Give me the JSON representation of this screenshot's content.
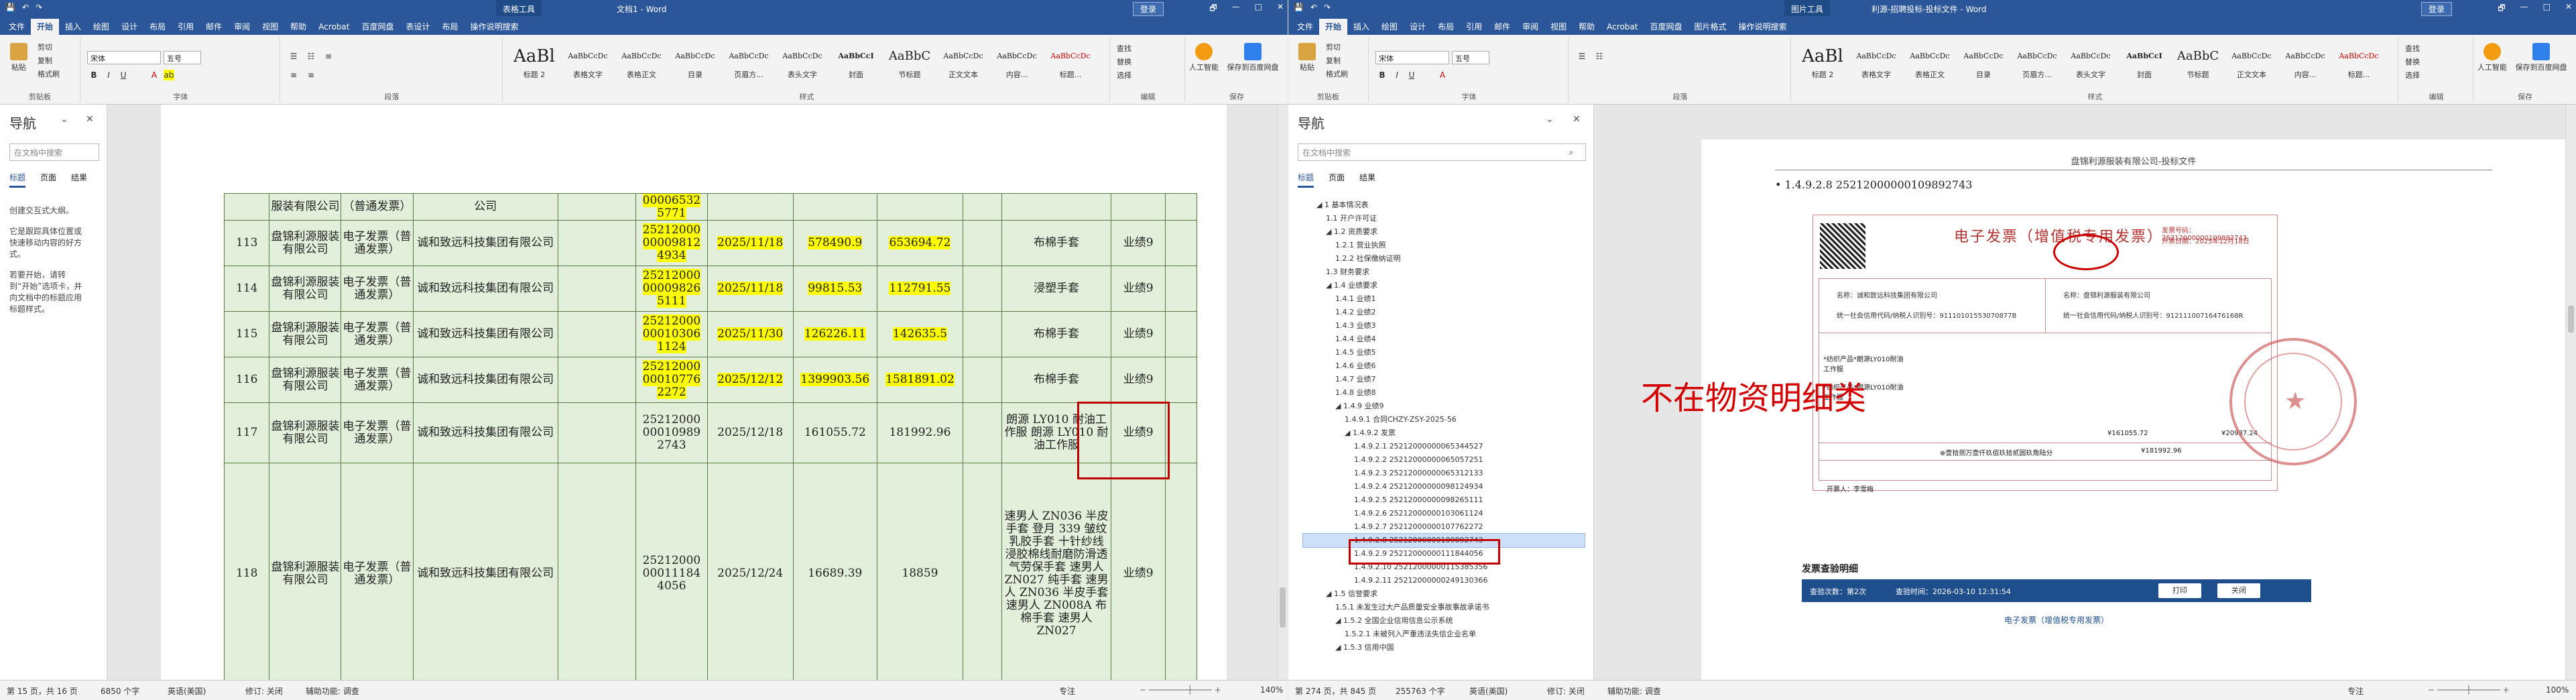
{
  "left": {
    "titlebar": {
      "context_tool": "表格工具",
      "doc_title": "文档1 - Word",
      "login": "登录",
      "controls": [
        "🗗",
        "—",
        "□",
        "✕"
      ]
    },
    "tabs": [
      "文件",
      "开始",
      "插入",
      "绘图",
      "设计",
      "布局",
      "引用",
      "邮件",
      "审阅",
      "视图",
      "帮助",
      "Acrobat",
      "百度网盘",
      "表设计",
      "布局",
      "操作说明搜索"
    ],
    "ribbon": {
      "paste": "粘贴",
      "cut": "剪切",
      "copy": "复制",
      "format_painter": "格式刷",
      "clipboard_label": "剪贴板",
      "font_name": "宋体",
      "font_size": "五号",
      "font_label": "字体",
      "paragraph_label": "段落",
      "styles_label": "样式",
      "styles": [
        {
          "preview": "AaBl",
          "name": "标题 2"
        },
        {
          "preview": "AaBbCcDc",
          "name": "表格文字"
        },
        {
          "preview": "AaBbCcDc",
          "name": "表格正文"
        },
        {
          "preview": "AaBbCcDc",
          "name": "目录"
        },
        {
          "preview": "AaBbCcDc",
          "name": "页眉方..."
        },
        {
          "preview": "AaBbCcDc",
          "name": "表头文字"
        },
        {
          "preview": "AaBbCcI",
          "name": "封面"
        },
        {
          "preview": "AaBbC",
          "name": "节标题"
        },
        {
          "preview": "AaBbCcDc",
          "name": "正文文本"
        },
        {
          "preview": "AaBbCcDc",
          "name": "内容..."
        },
        {
          "preview": "AaBbCcDc",
          "name": "标题..."
        }
      ],
      "find": "查找",
      "replace": "替换",
      "select": "选择",
      "edit_label": "编辑",
      "ai": "人工智能",
      "save_baidu": "保存到百度网盘",
      "save_label": "保存"
    },
    "nav": {
      "title": "导航",
      "search_placeholder": "在文档中搜索",
      "tabs": [
        "标题",
        "页面",
        "结果"
      ],
      "info": [
        "创建交互式大纲。",
        "它是跟踪具体位置或快速移动内容的好方式。",
        "若要开始，请转到“开始”选项卡，并向文档中的标题应用标题样式。"
      ]
    },
    "table_rows": [
      {
        "no": "",
        "company": "服装有限公司",
        "type": "（普通发票）",
        "seller": "公司",
        "inv_no": "00006532 5771",
        "date": "",
        "amount": "",
        "total": "",
        "item": "",
        "remark": "",
        "highlight": true
      },
      {
        "no": "113",
        "company": "盘锦利源服装有限公司",
        "type": "电子发票（普通发票）",
        "seller": "诚和致远科技集团有限公司",
        "inv_no": "25212000 00009812 4934",
        "date": "2025/11/18",
        "amount": "578490.9",
        "total": "653694.72",
        "item": "布棉手套",
        "remark": "业绩9",
        "highlight": true
      },
      {
        "no": "114",
        "company": "盘锦利源服装有限公司",
        "type": "电子发票（普通发票）",
        "seller": "诚和致远科技集团有限公司",
        "inv_no": "25212000 00009826 5111",
        "date": "2025/11/18",
        "amount": "99815.53",
        "total": "112791.55",
        "item": "浸塑手套",
        "remark": "业绩9",
        "highlight": true
      },
      {
        "no": "115",
        "company": "盘锦利源服装有限公司",
        "type": "电子发票（普通发票）",
        "seller": "诚和致远科技集团有限公司",
        "inv_no": "25212000 00010306 1124",
        "date": "2025/11/30",
        "amount": "126226.11",
        "total": "142635.5",
        "item": "布棉手套",
        "remark": "业绩9",
        "highlight": true
      },
      {
        "no": "116",
        "company": "盘锦利源服装有限公司",
        "type": "电子发票（普通发票）",
        "seller": "诚和致远科技集团有限公司",
        "inv_no": "25212000 00010776 2272",
        "date": "2025/12/12",
        "amount": "1399903.56",
        "total": "1581891.02",
        "item": "布棉手套",
        "remark": "业绩9",
        "highlight": true
      },
      {
        "no": "117",
        "company": "盘锦利源服装有限公司",
        "type": "电子发票（普通发票）",
        "seller": "诚和致远科技集团有限公司",
        "inv_no": "25212000 00010989 2743",
        "date": "2025/12/18",
        "amount": "161055.72",
        "total": "181992.96",
        "item": "朗源 LY010 耐油工作服 朗源 LY010 耐油工作服",
        "remark": "业绩9",
        "highlight": false
      },
      {
        "no": "118",
        "company": "盘锦利源服装有限公司",
        "type": "电子发票（普通发票）",
        "seller": "诚和致远科技集团有限公司",
        "inv_no": "25212000 00011184 4056",
        "date": "2025/12/24",
        "amount": "16689.39",
        "total": "18859",
        "item": "速男人 ZN036 半皮手套 登月 339 皱纹乳胶手套 十针纱线浸胶棉线耐磨防滑透气劳保手套 速男人 ZN027 纯手套 速男人 ZN036 半皮手套 速男人 ZN008A 布棉手套 速男人 ZN027",
        "remark": "业绩9",
        "highlight": false
      }
    ],
    "status": {
      "page": "第 15 页，共 16 页",
      "words": "6850 个字",
      "lang": "英语(美国)",
      "track": "修订: 关闭",
      "assist": "辅助功能: 调查",
      "focus": "专注",
      "zoom": "140%"
    }
  },
  "right": {
    "titlebar": {
      "context_tool": "图片工具",
      "doc_title": "利源-招聘投标-投标文件 - Word",
      "login": "登录",
      "controls": [
        "🗗",
        "—",
        "□",
        "✕"
      ]
    },
    "tabs": [
      "文件",
      "开始",
      "插入",
      "绘图",
      "设计",
      "布局",
      "引用",
      "邮件",
      "审阅",
      "视图",
      "帮助",
      "Acrobat",
      "百度网盘",
      "图片格式",
      "操作说明搜索"
    ],
    "nav": {
      "title": "导航",
      "search_placeholder": "在文档中搜索",
      "tabs": [
        "标题",
        "页面",
        "结果"
      ],
      "tree": [
        "◢ 1 基本情况表",
        "1.1 开户许可证",
        "◢ 1.2 资质要求",
        "1.2.1 营业执照",
        "1.2.2 社保缴纳证明",
        "1.3 财务要求",
        "◢ 1.4 业绩要求",
        "1.4.1 业绩1",
        "1.4.2 业绩2",
        "1.4.3 业绩3",
        "1.4.4 业绩4",
        "1.4.5 业绩5",
        "1.4.6 业绩6",
        "1.4.7 业绩7",
        "1.4.8 业绩8",
        "◢ 1.4.9 业绩9",
        "1.4.9.1 合同CHZY-ZSY-2025-56",
        "◢ 1.4.9.2 发票",
        "1.4.9.2.1 25212000000065344527",
        "1.4.9.2.2 25212000000065057251",
        "1.4.9.2.3 25212000000065312133",
        "1.4.9.2.4 25212000000098124934",
        "1.4.9.2.5 25212000000098265111",
        "1.4.9.2.6 25212000000103061124",
        "1.4.9.2.7 25212000000107762272",
        "1.4.9.2.8 25212000000109892743",
        "1.4.9.2.9 25212000000111844056",
        "1.4.9.2.10 25212000000115385356",
        "1.4.9.2.11 25212000000249130366",
        "◢ 1.5 信誉要求",
        "1.5.1 未发生过大产品质量安全事故事故承诺书",
        "◢ 1.5.2 全国企业信用信息公示系统",
        "1.5.2.1 未被列入严重违法失信企业名单",
        "◢ 1.5.3 信用中国"
      ],
      "highlight_index": 25
    },
    "page_header": "盘锦利源服装有限公司-投标文件",
    "heading": "1.4.9.2.8 25212000000109892743",
    "invoice": {
      "title": "电子发票（增值税专用发票）",
      "number_label": "发票号码：25212000000109892743",
      "date_label": "开票日期：2025年12月18日",
      "buyer": "名称：诚和致远科技集团有限公司",
      "buyer_tax": "统一社会信用代码/纳税人识别号：91110101553070877B",
      "seller": "名称：盘锦利源服装有限公司",
      "seller_tax": "统一社会信用代码/纳税人识别号：91211100716476168R",
      "item1": "*纺织产品*朗源LY010耐油工作服",
      "item2": "*纺织产品*朗源LY010耐油工作服",
      "total_cn": "⊗壹拾捌万壹仟玖佰玖拾贰圆玖角陆分",
      "total_num": "¥181992.96",
      "sum_amount": "¥161055.72",
      "sum_tax": "¥20937.24",
      "drawer": "开票人：李雪梅"
    },
    "annotation": "不在物资明细类",
    "verify": {
      "title": "发票查验明细",
      "count": "查验次数：第2次",
      "time": "查验时间：2026-03-10 12:31:54",
      "print": "打印",
      "close": "关闭",
      "sub": "电子发票（增值税专用发票）"
    },
    "status": {
      "page": "第 274 页，共 845 页",
      "words": "255763 个字",
      "lang": "英语(美国)",
      "track": "修订: 关闭",
      "assist": "辅助功能: 调查",
      "focus": "专注",
      "zoom": "100%"
    }
  }
}
